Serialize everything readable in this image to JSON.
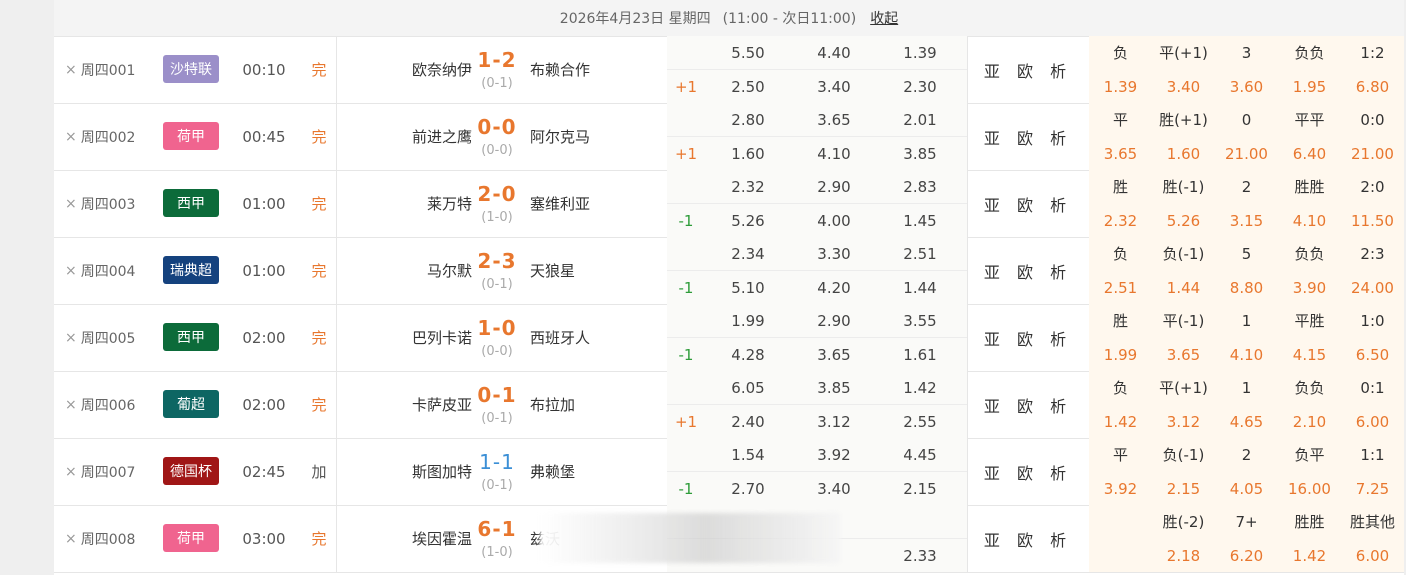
{
  "header": {
    "date_text": "2026年4月23日 星期四",
    "range_text": "(11:00 - 次日11:00)",
    "collapse_label": "收起"
  },
  "analysis_label": "亚 欧 析",
  "close_glyph": "×",
  "colors": {
    "accent_orange": "#e8772e",
    "handicap_green": "#2e9c3a",
    "score_blue": "#3b8fd6"
  },
  "matches": [
    {
      "num": "周四001",
      "league": "沙特联",
      "league_color": "#9b8fc9",
      "time": "00:10",
      "status": "完",
      "status_color": "#e8772e",
      "home": "欧奈纳伊",
      "score": "1-2",
      "score_style": "orange",
      "half": "(0-1)",
      "away": "布赖合作",
      "odds1": [
        "5.50",
        "4.40",
        "1.39"
      ],
      "handicap": "+1",
      "handicap_type": "plus",
      "odds2": [
        "2.50",
        "3.40",
        "2.30"
      ],
      "res_hdr": [
        "负",
        "平(+1)",
        "3",
        "负负",
        "1:2"
      ],
      "res_val": [
        "1.39",
        "3.40",
        "3.60",
        "1.95",
        "6.80"
      ]
    },
    {
      "num": "周四002",
      "league": "荷甲",
      "league_color": "#f0648f",
      "time": "00:45",
      "status": "完",
      "status_color": "#e8772e",
      "home": "前进之鹰",
      "score": "0-0",
      "score_style": "orange",
      "half": "(0-0)",
      "away": "阿尔克马",
      "odds1": [
        "2.80",
        "3.65",
        "2.01"
      ],
      "handicap": "+1",
      "handicap_type": "plus",
      "odds2": [
        "1.60",
        "4.10",
        "3.85"
      ],
      "res_hdr": [
        "平",
        "胜(+1)",
        "0",
        "平平",
        "0:0"
      ],
      "res_val": [
        "3.65",
        "1.60",
        "21.00",
        "6.40",
        "21.00"
      ]
    },
    {
      "num": "周四003",
      "league": "西甲",
      "league_color": "#0c6b3a",
      "time": "01:00",
      "status": "完",
      "status_color": "#e8772e",
      "home": "莱万特",
      "score": "2-0",
      "score_style": "orange",
      "half": "(1-0)",
      "away": "塞维利亚",
      "odds1": [
        "2.32",
        "2.90",
        "2.83"
      ],
      "handicap": "-1",
      "handicap_type": "minus",
      "odds2": [
        "5.26",
        "4.00",
        "1.45"
      ],
      "res_hdr": [
        "胜",
        "胜(-1)",
        "2",
        "胜胜",
        "2:0"
      ],
      "res_val": [
        "2.32",
        "5.26",
        "3.15",
        "4.10",
        "11.50"
      ]
    },
    {
      "num": "周四004",
      "league": "瑞典超",
      "league_color": "#15427e",
      "time": "01:00",
      "status": "完",
      "status_color": "#e8772e",
      "home": "马尔默",
      "score": "2-3",
      "score_style": "orange",
      "half": "(0-1)",
      "away": "天狼星",
      "odds1": [
        "2.34",
        "3.30",
        "2.51"
      ],
      "handicap": "-1",
      "handicap_type": "minus",
      "odds2": [
        "5.10",
        "4.20",
        "1.44"
      ],
      "res_hdr": [
        "负",
        "负(-1)",
        "5",
        "负负",
        "2:3"
      ],
      "res_val": [
        "2.51",
        "1.44",
        "8.80",
        "3.90",
        "24.00"
      ]
    },
    {
      "num": "周四005",
      "league": "西甲",
      "league_color": "#0c6b3a",
      "time": "02:00",
      "status": "完",
      "status_color": "#e8772e",
      "home": "巴列卡诺",
      "score": "1-0",
      "score_style": "orange",
      "half": "(0-0)",
      "away": "西班牙人",
      "odds1": [
        "1.99",
        "2.90",
        "3.55"
      ],
      "handicap": "-1",
      "handicap_type": "minus",
      "odds2": [
        "4.28",
        "3.65",
        "1.61"
      ],
      "res_hdr": [
        "胜",
        "平(-1)",
        "1",
        "平胜",
        "1:0"
      ],
      "res_val": [
        "1.99",
        "3.65",
        "4.10",
        "4.15",
        "6.50"
      ]
    },
    {
      "num": "周四006",
      "league": "葡超",
      "league_color": "#0d6663",
      "time": "02:00",
      "status": "完",
      "status_color": "#e8772e",
      "home": "卡萨皮亚",
      "score": "0-1",
      "score_style": "orange",
      "half": "(0-1)",
      "away": "布拉加",
      "odds1": [
        "6.05",
        "3.85",
        "1.42"
      ],
      "handicap": "+1",
      "handicap_type": "plus",
      "odds2": [
        "2.40",
        "3.12",
        "2.55"
      ],
      "res_hdr": [
        "负",
        "平(+1)",
        "1",
        "负负",
        "0:1"
      ],
      "res_val": [
        "1.42",
        "3.12",
        "4.65",
        "2.10",
        "6.00"
      ]
    },
    {
      "num": "周四007",
      "league": "德国杯",
      "league_color": "#a01616",
      "time": "02:45",
      "status": "加",
      "status_color": "#555555",
      "home": "斯图加特",
      "score": "1-1",
      "score_style": "blue",
      "half": "(0-1)",
      "away": "弗赖堡",
      "odds1": [
        "1.54",
        "3.92",
        "4.45"
      ],
      "handicap": "-1",
      "handicap_type": "minus",
      "odds2": [
        "2.70",
        "3.40",
        "2.15"
      ],
      "res_hdr": [
        "平",
        "负(-1)",
        "2",
        "负平",
        "1:1"
      ],
      "res_val": [
        "3.92",
        "2.15",
        "4.05",
        "16.00",
        "7.25"
      ]
    },
    {
      "num": "周四008",
      "league": "荷甲",
      "league_color": "#f0648f",
      "time": "03:00",
      "status": "完",
      "status_color": "#e8772e",
      "home": "埃因霍温",
      "score": "6-1",
      "score_style": "orange",
      "half": "(1-0)",
      "away": "兹沃",
      "odds1": [
        "",
        "",
        ""
      ],
      "handicap": "",
      "handicap_type": "minus",
      "odds2": [
        "",
        "",
        "2.33"
      ],
      "res_hdr": [
        "",
        "胜(-2)",
        "7+",
        "胜胜",
        "胜其他"
      ],
      "res_val": [
        "",
        "2.18",
        "6.20",
        "1.42",
        "6.00"
      ]
    }
  ]
}
